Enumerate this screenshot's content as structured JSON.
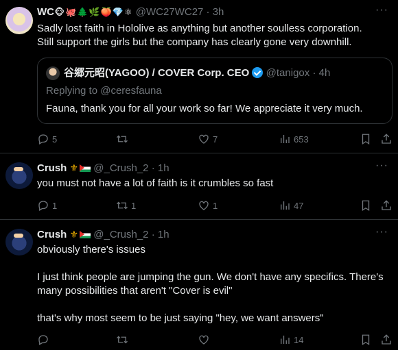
{
  "tweets": [
    {
      "author_name": "WC",
      "emojis": "🐵🐙🌲🌿🍑💎⚛",
      "handle": "@WC27WC27",
      "time": "3h",
      "text_line1": "Sadly lost faith in Hololive as anything but another soulless corporation.",
      "text_line2": "Still support the girls but the company has clearly gone very downhill.",
      "quote": {
        "author_name": "谷郷元昭(YAGOO) / COVER Corp. CEO",
        "handle": "@tanigox",
        "time": "4h",
        "replying": "Replying to @ceresfauna",
        "text": "Fauna, thank you for all your work so far! We appreciate it very much."
      },
      "stats": {
        "replies": "5",
        "retweets": "",
        "likes": "7",
        "views": "653"
      }
    },
    {
      "author_name": "Crush",
      "handle": "@_Crush_2",
      "time": "1h",
      "text": "you must not have a lot of faith is it crumbles so fast",
      "stats": {
        "replies": "1",
        "retweets": "1",
        "likes": "1",
        "views": "47"
      }
    },
    {
      "author_name": "Crush",
      "handle": "@_Crush_2",
      "time": "1h",
      "paragraph1": "obviously there's issues",
      "paragraph2_line1": "I just think people are jumping the gun. We don't have any specifics. There's",
      "paragraph2_line2": "many possibilities that aren't \"Cover is evil\"",
      "paragraph3": "that's why most seem to be just saying \"hey, we want answers\"",
      "stats": {
        "replies": "",
        "retweets": "",
        "likes": "",
        "views": "14"
      }
    }
  ],
  "colors": {
    "background": "#000000",
    "text": "#e7e9ea",
    "muted": "#71767b",
    "border": "#2f3336",
    "verified": "#1d9bf0"
  }
}
